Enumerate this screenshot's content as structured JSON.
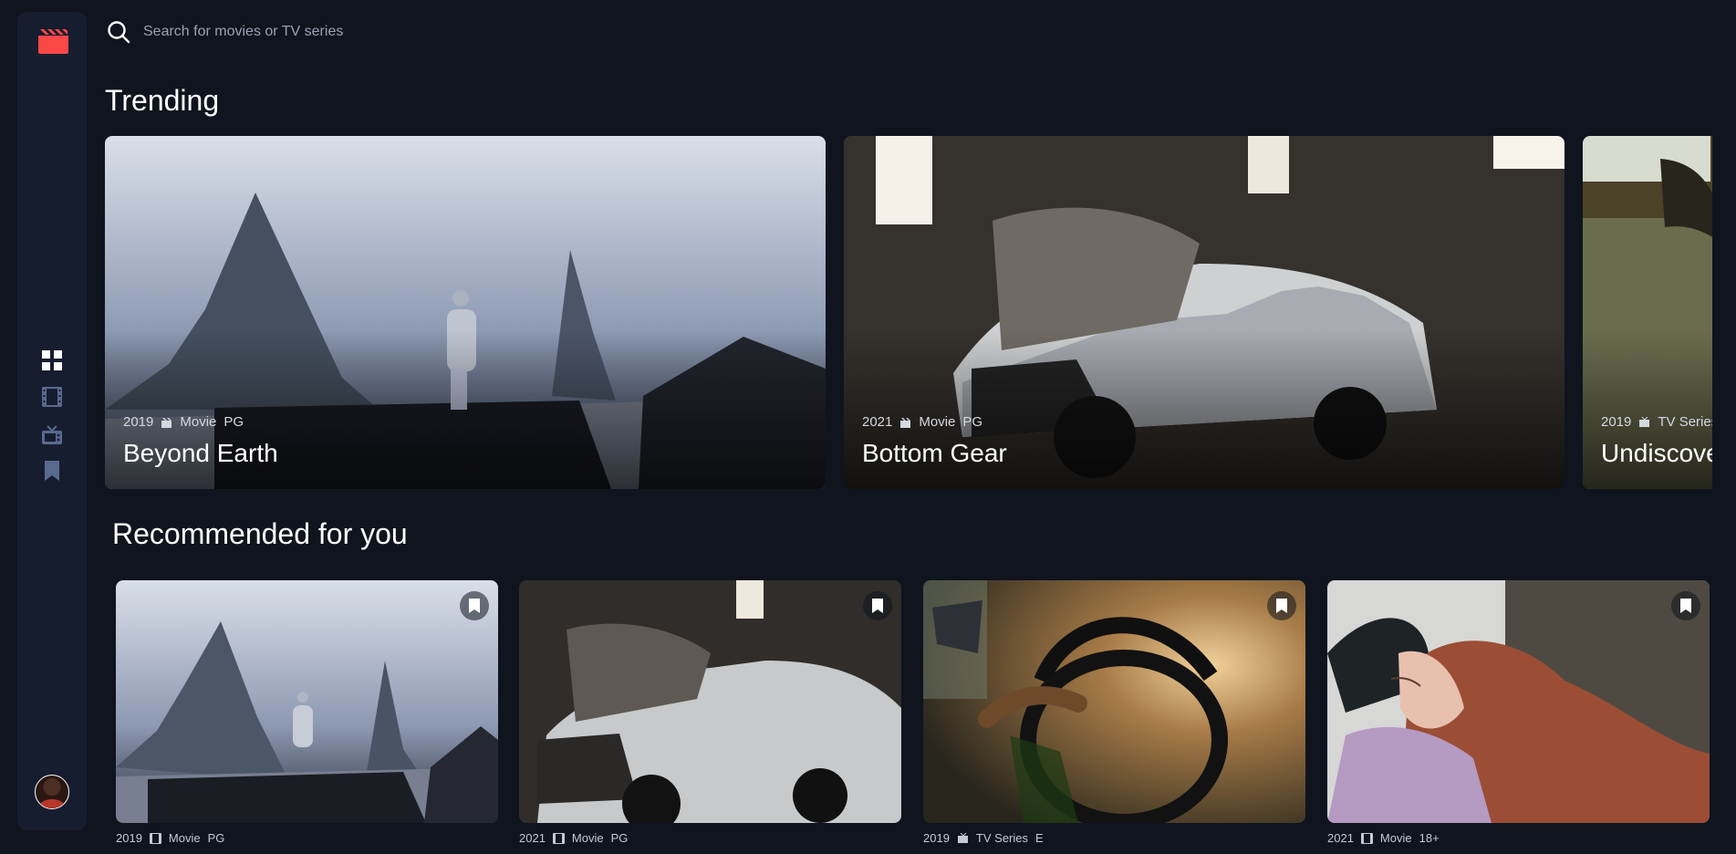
{
  "search": {
    "placeholder": "Search for movies or TV series"
  },
  "sections": {
    "trending": "Trending",
    "recommended": "Recommended for you"
  },
  "trending": [
    {
      "year": "2019",
      "type": "Movie",
      "rating": "PG",
      "title": "Beyond Earth",
      "icon": "movie-icon"
    },
    {
      "year": "2021",
      "type": "Movie",
      "rating": "PG",
      "title": "Bottom Gear",
      "icon": "movie-icon"
    },
    {
      "year": "2019",
      "type": "TV Series",
      "rating": "",
      "title": "Undiscove",
      "icon": "tv-icon"
    }
  ],
  "recommended": [
    {
      "year": "2019",
      "category": "Movie",
      "rating": "PG",
      "icon": "film-icon"
    },
    {
      "year": "2021",
      "category": "Movie",
      "rating": "PG",
      "icon": "film-icon"
    },
    {
      "year": "2019",
      "category": "TV Series",
      "rating": "E",
      "icon": "tv-icon"
    },
    {
      "year": "2021",
      "category": "Movie",
      "rating": "18+",
      "icon": "film-icon"
    }
  ],
  "colors": {
    "background": "#10141e",
    "sidebar": "#161d2f",
    "accent": "#fc4747",
    "nav_muted": "#5a698f",
    "nav_active": "#ffffff"
  },
  "icons": {
    "logo": "clapperboard-icon",
    "nav": [
      "home-grid-icon",
      "movie-film-icon",
      "tv-icon",
      "bookmark-icon"
    ]
  }
}
